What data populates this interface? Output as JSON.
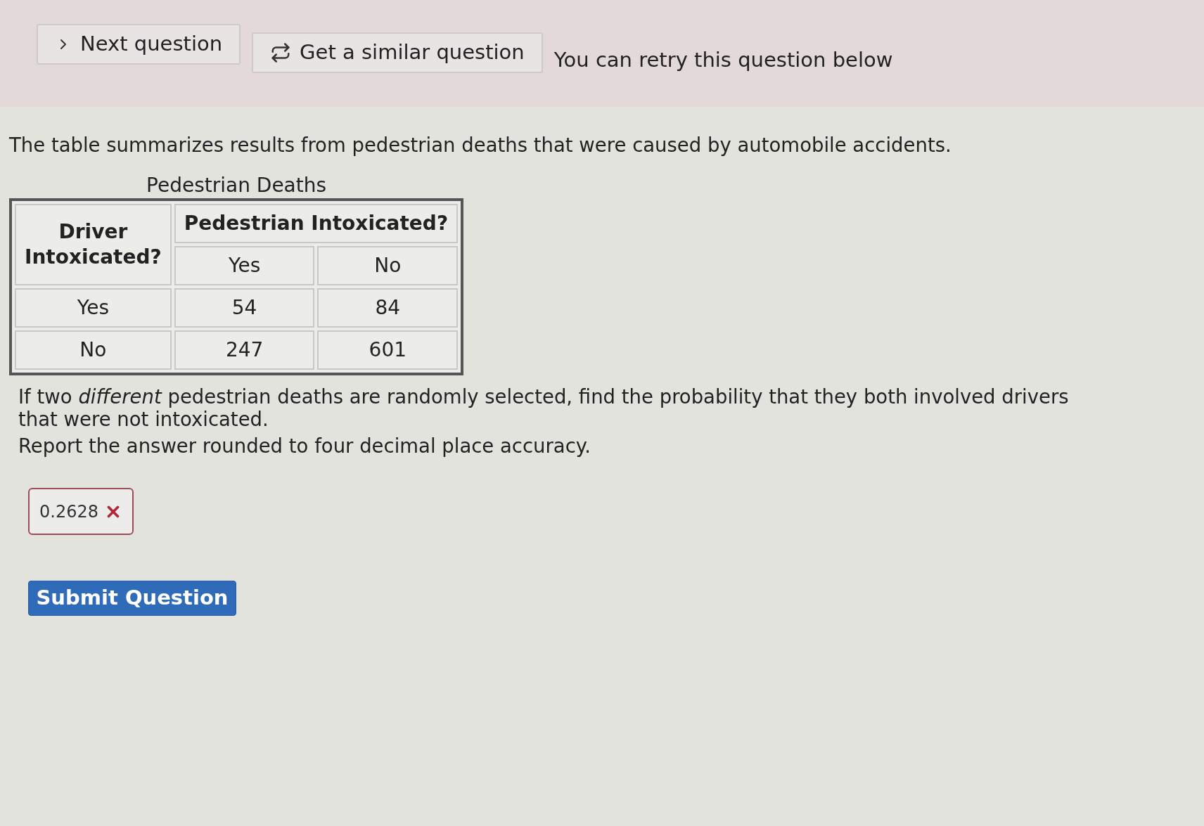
{
  "toolbar": {
    "buttons": [
      {
        "kind": "next",
        "label": "Next question"
      },
      {
        "kind": "similar",
        "label": "Get a similar question"
      }
    ],
    "message": "You can retry this question below"
  },
  "intro": "The table summarizes results from pedestrian deaths that were caused by automobile accidents.",
  "table": {
    "caption": "Pedestrian Deaths",
    "row_header": "Driver Intoxicated?",
    "column_group": "Pedestrian Intoxicated?",
    "columns": [
      "Yes",
      "No"
    ],
    "rows": [
      {
        "label": "Yes",
        "cells": [
          "54",
          "84"
        ]
      },
      {
        "label": "No",
        "cells": [
          "247",
          "601"
        ]
      }
    ]
  },
  "question": {
    "text": "If two *different* pedestrian deaths are randomly selected, find the probability that they both involved drivers that were not intoxicated.",
    "instruction": "Report the answer rounded to four decimal place accuracy."
  },
  "answer": {
    "value": "0.2628",
    "correct": false
  },
  "submit": {
    "label": "Submit Question"
  }
}
